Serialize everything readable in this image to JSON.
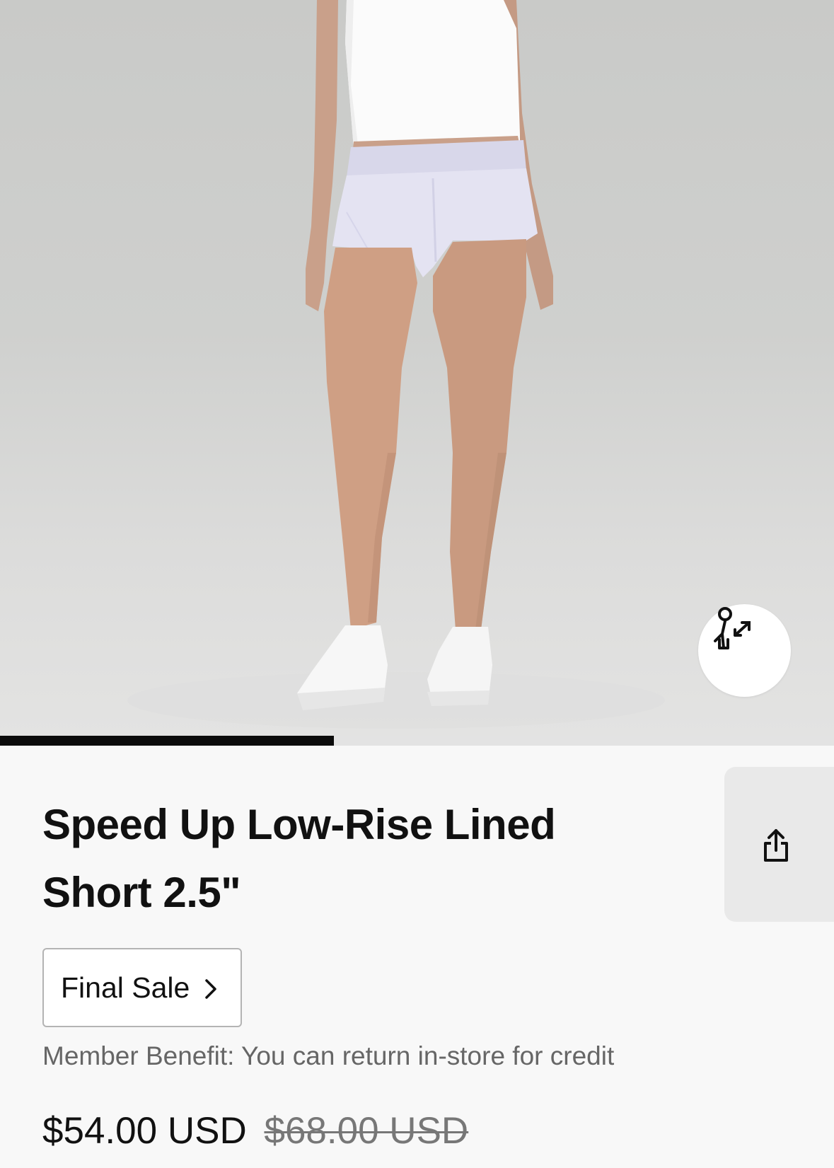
{
  "product": {
    "title_line1": "Speed Up Low-Rise Lined",
    "title_line2": "Short 2.5\""
  },
  "gallery": {
    "progress_fraction": 0.4,
    "fit_button_icon": "size-fit-icon"
  },
  "share": {
    "icon": "share-icon"
  },
  "badge": {
    "label": "Final Sale",
    "icon": "chevron-right-icon"
  },
  "benefit_text": "Member Benefit: You can return in-store for credit",
  "price": {
    "current": "$54.00 USD",
    "original": "$68.00 USD"
  },
  "colors": {
    "accent": "#0b0b0b",
    "shorts": "#e2e1f1"
  }
}
